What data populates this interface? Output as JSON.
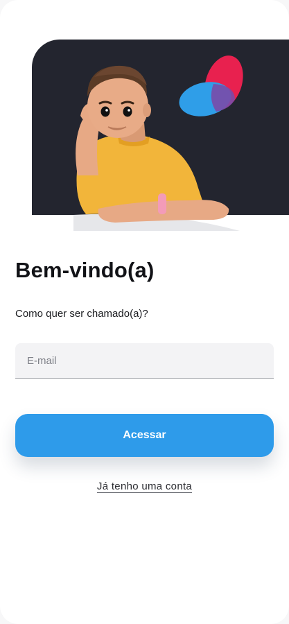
{
  "welcome": {
    "title": "Bem-vindo(a)",
    "subtitle": "Como quer ser chamado(a)?"
  },
  "form": {
    "email_placeholder": "E-mail",
    "email_value": ""
  },
  "actions": {
    "primary_label": "Acessar",
    "secondary_link": "Já tenho uma conta"
  },
  "theme": {
    "hero_background": "#23252f",
    "primary_color": "#2e9bea",
    "logo_red": "#e8214f",
    "logo_blue": "#2f9ee8",
    "logo_overlap": "#7a4aa8"
  },
  "icons": {
    "brand_logo": "overlapping-red-blue-ellipses-logo",
    "hero_illustration": "3d-boy-leaning-on-ledge-illustration"
  }
}
